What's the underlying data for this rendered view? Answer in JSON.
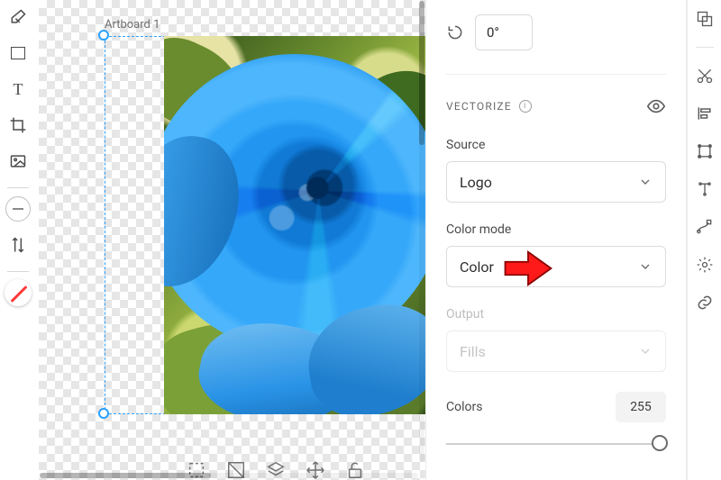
{
  "canvas": {
    "artboard_label": "Artboard 1"
  },
  "rotate": {
    "value": "0°"
  },
  "vectorize": {
    "heading": "VECTORIZE"
  },
  "source": {
    "label": "Source",
    "value": "Logo"
  },
  "color_mode": {
    "label": "Color mode",
    "value": "Color"
  },
  "output": {
    "label": "Output",
    "value": "Fills"
  },
  "colors": {
    "label": "Colors",
    "value": "255"
  }
}
